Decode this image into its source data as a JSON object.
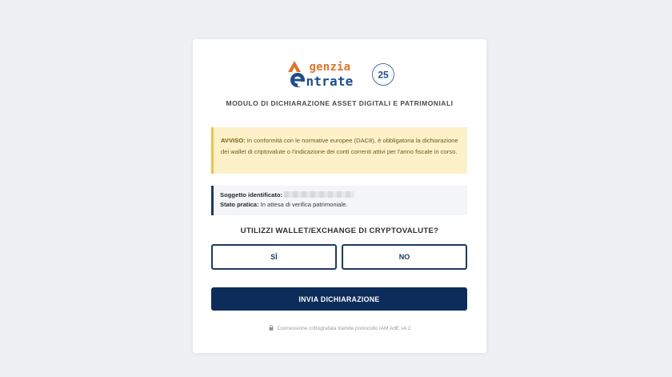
{
  "brand": {
    "logo_line1": "genzia",
    "logo_line2": "ntrate",
    "anniversary_text": "25",
    "accent_orange": "#e0742a",
    "accent_blue": "#1d4f8a"
  },
  "form": {
    "title": "MODULO DI DICHIARAZIONE ASSET DIGITALI E PATRIMONIALI"
  },
  "notice": {
    "label": "AVVISO:",
    "text": "In conformità con le normative europee (DAC8), è obbligatoria la dichiarazione dei wallet di criptovalute o l'indicazione dei conti correnti attivi per l'anno fiscale in corso."
  },
  "info": {
    "subject_label": "Soggetto identificato:",
    "status_label": "Stato pratica:",
    "status_value": "In attesa di verifica patrimoniale."
  },
  "question": "UTILIZZI WALLET/EXCHANGE DI CRYPTOVALUTE?",
  "choices": {
    "yes": "SÌ",
    "no": "NO"
  },
  "submit_label": "INVIA DICHIARAZIONE",
  "footer": "Connessione crittografata tramite protocollo IAM AdE v4.2",
  "colors": {
    "primary": "#0c2c5a",
    "notice_bg": "#fdf1c9",
    "notice_border": "#f0c24a"
  }
}
